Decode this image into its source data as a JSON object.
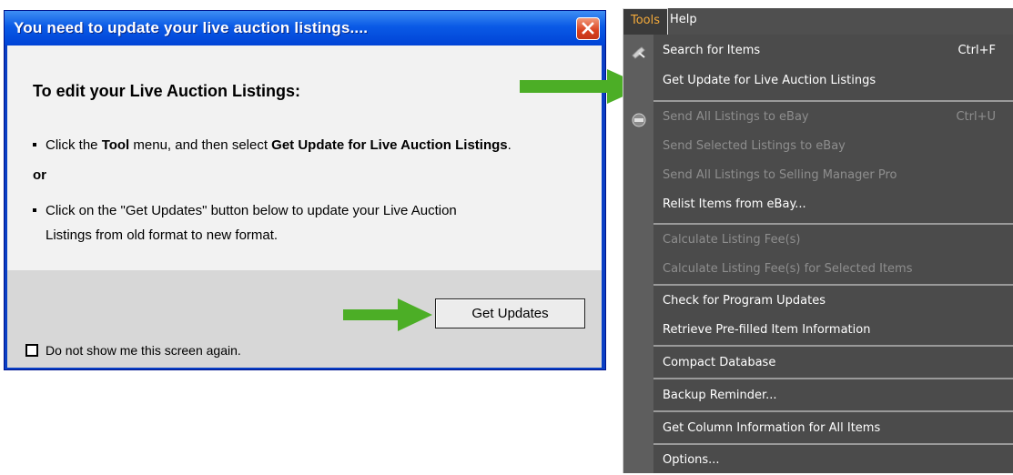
{
  "dialog": {
    "title": "You need to update your live auction listings....",
    "heading": "To edit your Live Auction Listings:",
    "line1_pre": "Click the ",
    "line1_bold1": "Tool",
    "line1_mid": " menu, and then select ",
    "line1_bold2": "Get Update for Live Auction Listings",
    "line1_post": ".",
    "or": "or",
    "line2a": "Click on the \"Get Updates\" button below to update your  Live Auction",
    "line2b": "Listings from old format to new format.",
    "button": "Get Updates",
    "checkbox_label": "Do not show me this screen again."
  },
  "menubar": {
    "tools": "Tools",
    "help": "Help"
  },
  "menu": {
    "items": [
      {
        "label": "Search for Items",
        "shortcut": "Ctrl+F",
        "enabled": true
      },
      {
        "label": "Get Update for Live Auction Listings",
        "shortcut": "",
        "enabled": true
      },
      {
        "label": "Send All Listings to eBay",
        "shortcut": "Ctrl+U",
        "enabled": false
      },
      {
        "label": "Send Selected Listings to eBay",
        "shortcut": "",
        "enabled": false
      },
      {
        "label": "Send All Listings to Selling Manager Pro",
        "shortcut": "",
        "enabled": false
      },
      {
        "label": "Relist Items from eBay...",
        "shortcut": "",
        "enabled": true
      },
      {
        "label": "Calculate Listing Fee(s)",
        "shortcut": "",
        "enabled": false
      },
      {
        "label": "Calculate Listing Fee(s) for Selected Items",
        "shortcut": "",
        "enabled": false
      },
      {
        "label": "Check for Program Updates",
        "shortcut": "",
        "enabled": true
      },
      {
        "label": "Retrieve Pre-filled Item Information",
        "shortcut": "",
        "enabled": true
      },
      {
        "label": "Compact Database",
        "shortcut": "",
        "enabled": true
      },
      {
        "label": "Backup Reminder...",
        "shortcut": "",
        "enabled": true
      },
      {
        "label": "Get Column Information for All Items",
        "shortcut": "",
        "enabled": true
      },
      {
        "label": "Options...",
        "shortcut": "",
        "enabled": true
      }
    ]
  },
  "colors": {
    "arrow": "#4cae26",
    "title_bar": "#0a5ae6",
    "menu_bg": "#4b4b4b",
    "tools_accent": "#f2a93a"
  },
  "icons": [
    "close-icon",
    "checkbox-icon",
    "search-items-icon",
    "send-listings-icon",
    "arrow-icon"
  ]
}
